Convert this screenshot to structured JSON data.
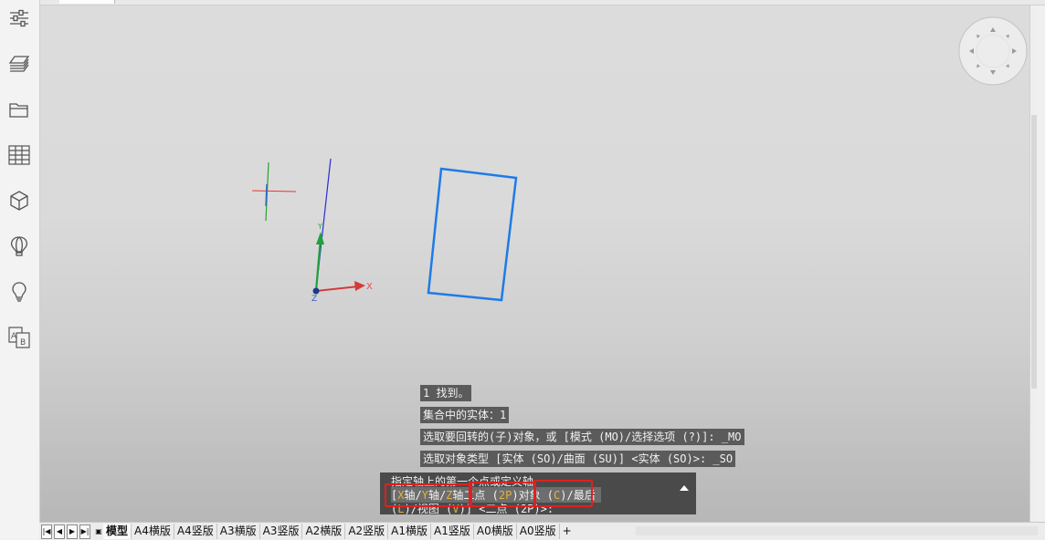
{
  "toolbar": {
    "items": [
      {
        "name": "properties-icon"
      },
      {
        "name": "layers-icon"
      },
      {
        "name": "folder-icon"
      },
      {
        "name": "table-icon"
      },
      {
        "name": "cube-icon"
      },
      {
        "name": "balloon-icon"
      },
      {
        "name": "lightbulb-icon"
      },
      {
        "name": "text-style-icon"
      }
    ]
  },
  "viewport": {
    "axis_label_z": "Z",
    "axis_label_x": "X",
    "axis_label_y": "Y",
    "rect_color": "#1e7be6"
  },
  "command_history": [
    "1 找到。",
    "集合中的实体：1",
    "选取要回转的(子)对象，或 [模式 (MO)/选择选项 (?)]: _MO",
    "选取对象类型 [实体 (SO)/曲面 (SU)] <实体 (SO)>: _SO"
  ],
  "command_prompt": {
    "line1": "指定轴上的第一个点或定义轴",
    "open_bracket": "[",
    "x_key": "X",
    "x_label": "轴/",
    "y_key": "Y",
    "y_label": "轴/",
    "z_key": "Z",
    "z_label": "轴",
    "two_point": "二点 (",
    "two_point_key": "2P",
    "two_point_close": ")",
    "object": "对象 (",
    "object_key": "C",
    "object_close": ")",
    "last": "/最后",
    "line3_a": "(",
    "line3_l": "L",
    "line3_b": ")/视图 (",
    "line3_v": "V",
    "line3_c": ")] <二点 (2P)>:"
  },
  "layout_tabs": {
    "nav": [
      "|◀",
      "◀",
      "▶",
      "▶|"
    ],
    "model_icon": "▣",
    "tabs": [
      "模型",
      "A4横版",
      "A4竖版",
      "A3横版",
      "A3竖版",
      "A2横版",
      "A2竖版",
      "A1横版",
      "A1竖版",
      "A0横版",
      "A0竖版"
    ],
    "add": "+"
  }
}
